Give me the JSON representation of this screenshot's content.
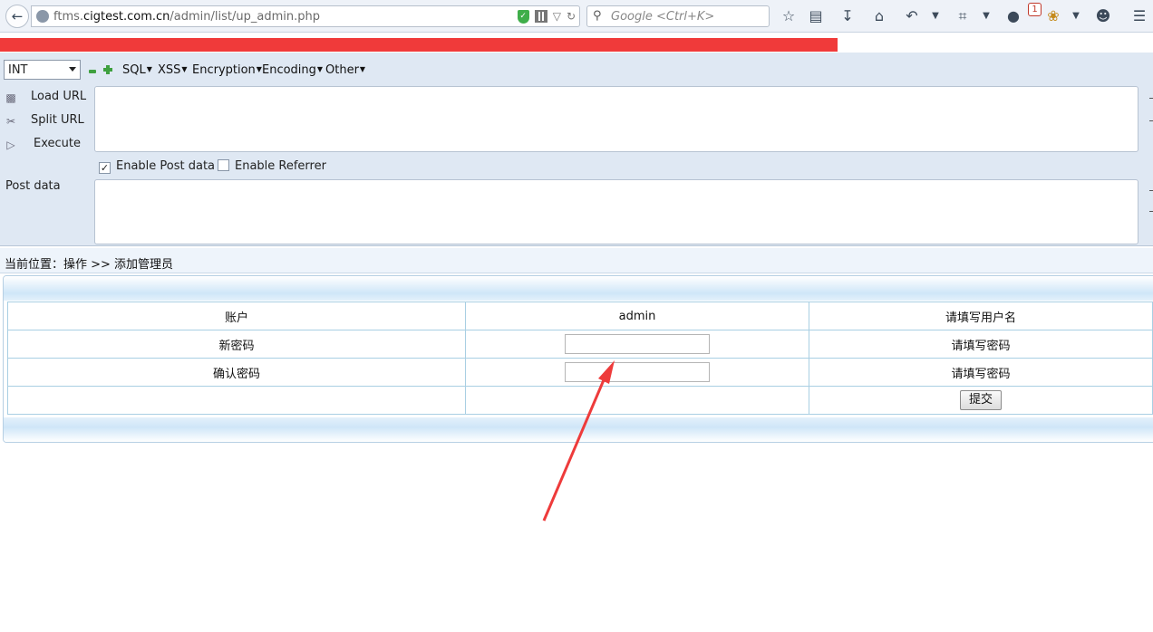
{
  "browser": {
    "url_prefix": "ftms.",
    "url_domain": "cigtest.com.cn",
    "url_path": "/admin/list/up_admin.php",
    "search_placeholder": "Google <Ctrl+K>",
    "notification_count": "1"
  },
  "hackbar": {
    "type_select": "INT",
    "menus": [
      "SQL",
      "XSS",
      "Encryption",
      "Encoding",
      "Other"
    ],
    "load_url": "Load URL",
    "split_url": "Split URL",
    "execute": "Execute",
    "enable_post": "Enable Post data",
    "enable_post_checked": true,
    "enable_referrer": "Enable Referrer",
    "enable_referrer_checked": false,
    "post_label": "Post data",
    "url_value": "",
    "post_value": ""
  },
  "page": {
    "breadcrumb": "当前位置：操作 >> 添加管理员",
    "rows": [
      {
        "label": "账户",
        "value": "admin",
        "hint": "请填写用户名"
      },
      {
        "label": "新密码",
        "value": "",
        "hint": "请填写密码"
      },
      {
        "label": "确认密码",
        "value": "",
        "hint": "请填写密码"
      }
    ],
    "submit_label": "提交"
  },
  "colors": {
    "hackbar_bg": "#dfe8f3",
    "hint_red": "#b01818",
    "arrow_red": "#ee3b3b",
    "redact_red": "#f03a3a"
  }
}
